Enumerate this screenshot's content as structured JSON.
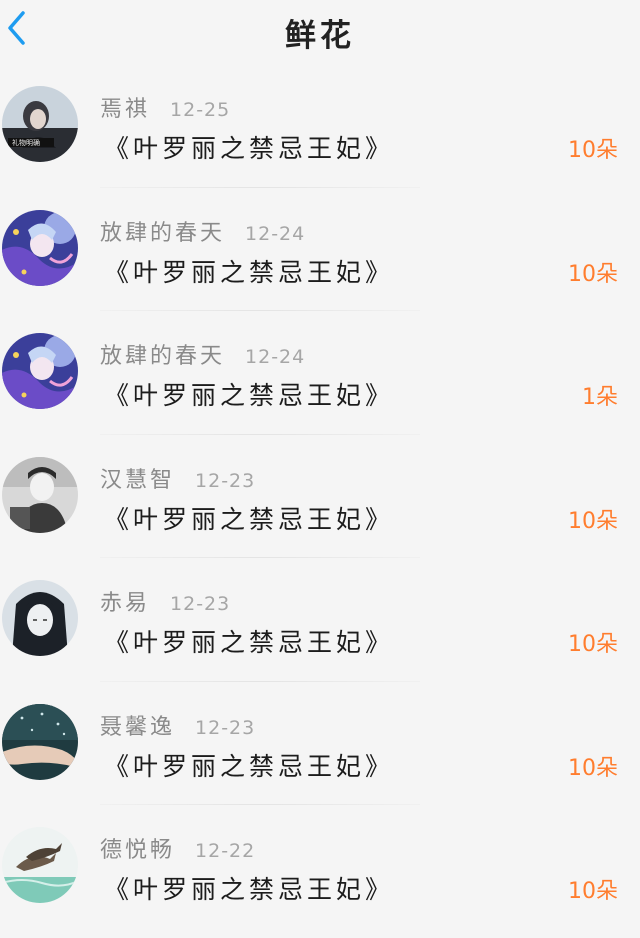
{
  "header": {
    "title": "鲜花",
    "back_icon": "chevron-left-icon",
    "accent_color": "#1e9cf0"
  },
  "flower_color": "#ff7d2e",
  "gifts": [
    {
      "user": "焉祺",
      "date": "12-25",
      "book": "《叶罗丽之禁忌王妃》",
      "count": "10朵",
      "avatar": "dark-portrait"
    },
    {
      "user": "放肆的春天",
      "date": "12-24",
      "book": "《叶罗丽之禁忌王妃》",
      "count": "10朵",
      "avatar": "anime-purple"
    },
    {
      "user": "放肆的春天",
      "date": "12-24",
      "book": "《叶罗丽之禁忌王妃》",
      "count": "1朵",
      "avatar": "anime-purple"
    },
    {
      "user": "汉慧智",
      "date": "12-23",
      "book": "《叶罗丽之禁忌王妃》",
      "count": "10朵",
      "avatar": "grayscale-portrait"
    },
    {
      "user": "赤易",
      "date": "12-23",
      "book": "《叶罗丽之禁忌王妃》",
      "count": "10朵",
      "avatar": "anime-dark-hair"
    },
    {
      "user": "聂馨逸",
      "date": "12-23",
      "book": "《叶罗丽之禁忌王妃》",
      "count": "10朵",
      "avatar": "hand-rain"
    },
    {
      "user": "德悦畅",
      "date": "12-22",
      "book": "《叶罗丽之禁忌王妃》",
      "count": "10朵",
      "avatar": "dolphins"
    }
  ]
}
